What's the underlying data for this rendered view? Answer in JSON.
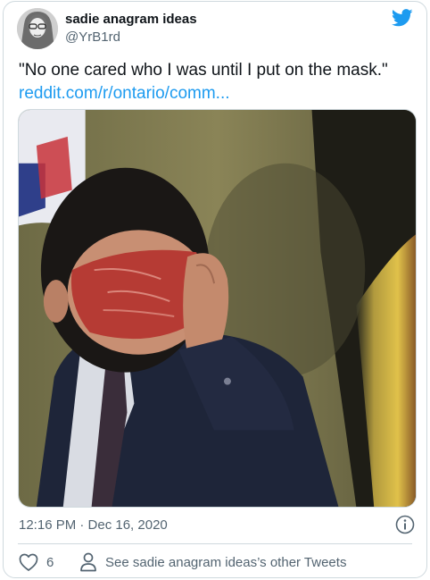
{
  "author": {
    "display_name": "sadie anagram ideas",
    "handle": "@YrB1rd"
  },
  "tweet": {
    "text": "\"No one cared who I was until I put on the mask.\"",
    "link": "reddit.com/r/ontario/comm..."
  },
  "meta": {
    "timestamp": "12:16 PM · Dec 16, 2020"
  },
  "actions": {
    "like_count": "6",
    "other_tweets_label": "See sadie anagram ideas’s other Tweets"
  },
  "colors": {
    "link": "#1d9bf0",
    "secondary_text": "#536471",
    "border": "#cfd9de",
    "brand": "#1d9bf0"
  },
  "icons": {
    "brand": "twitter-bird-icon",
    "info": "info-icon",
    "like": "heart-icon",
    "profile": "person-icon"
  }
}
